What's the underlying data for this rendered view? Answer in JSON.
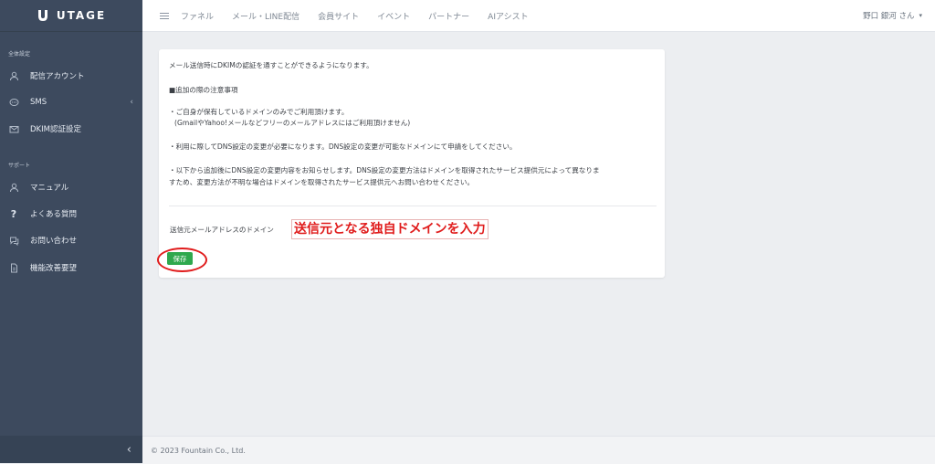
{
  "brand": {
    "name": "UTAGE"
  },
  "topnav": {
    "items": [
      "ファネル",
      "メール・LINE配信",
      "会員サイト",
      "イベント",
      "パートナー",
      "AIアシスト"
    ],
    "user": "野口 銀河 さん"
  },
  "sidebar": {
    "section1_label": "全体設定",
    "section1_items": [
      {
        "label": "配信アカウント",
        "icon": "person-icon"
      },
      {
        "label": "SMS",
        "icon": "chat-bubble-icon"
      },
      {
        "label": "DKIM認証設定",
        "icon": "envelope-icon"
      }
    ],
    "section2_label": "サポート",
    "section2_items": [
      {
        "label": "マニュアル",
        "icon": "person-icon"
      },
      {
        "label": "よくある質問",
        "icon": "question-icon"
      },
      {
        "label": "お問い合わせ",
        "icon": "chat-icon"
      },
      {
        "label": "機能改善要望",
        "icon": "document-icon"
      }
    ]
  },
  "content": {
    "intro": "メール送信時にDKIMの認証を通すことができるようになります。",
    "notes_heading": "■追加の際の注意事項",
    "note1_line1": "・ご自身が保有しているドメインのみでご利用頂けます。",
    "note1_line2": "(GmailやYahoo!メールなどフリーのメールアドレスにはご利用頂けません)",
    "note2": "・利用に際してDNS設定の変更が必要になります。DNS設定の変更が可能なドメインにて申請をしてください。",
    "note3_line1": "・以下から追加後にDNS設定の変更内容をお知らせします。DNS設定の変更方法はドメインを取得されたサービス提供元によって異なりま",
    "note3_line2": "すため、変更方法が不明な場合はドメインを取得されたサービス提供元へお問い合わせください。",
    "field_label": "送信元メールアドレスのドメイン",
    "field_annotation": "送信元となる独自ドメインを入力",
    "save_label": "保存"
  },
  "footer": {
    "copyright": "© 2023 Fountain Co., Ltd."
  },
  "colors": {
    "sidebar": "#3d4a5e",
    "accent_green": "#2ea84d",
    "annotation_red": "#e01c1c"
  }
}
